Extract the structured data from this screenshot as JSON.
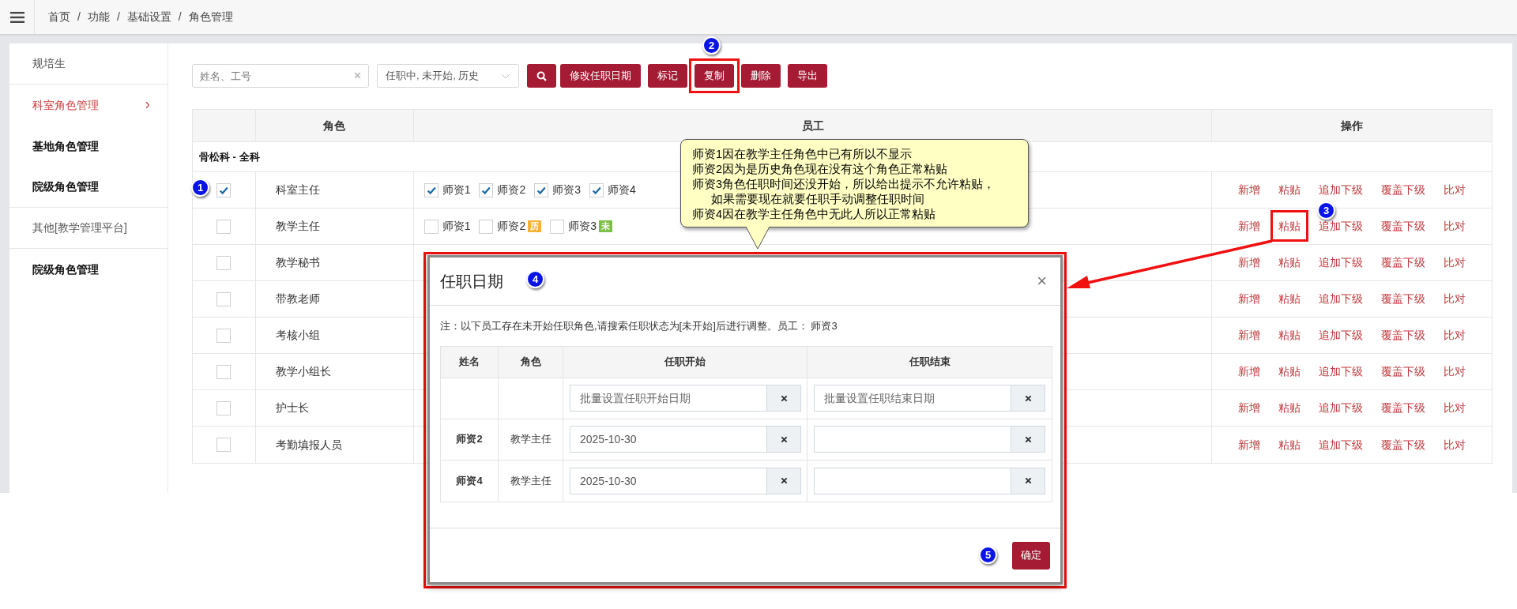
{
  "header": {
    "breadcrumb": [
      "首页",
      "功能",
      "基础设置",
      "角色管理"
    ],
    "separator": "/"
  },
  "sidebar": {
    "items": [
      {
        "label": "规培生",
        "kind": "plain",
        "selected": false,
        "divided": true
      },
      {
        "label": "科室角色管理",
        "kind": "strong",
        "selected": true,
        "divided": false
      },
      {
        "label": "基地角色管理",
        "kind": "strong",
        "selected": false,
        "divided": false
      },
      {
        "label": "院级角色管理",
        "kind": "strong",
        "selected": false,
        "divided": true
      },
      {
        "label": "其他[教学管理平台]",
        "kind": "plain",
        "selected": false,
        "divided": true
      },
      {
        "label": "院级角色管理",
        "kind": "strong",
        "selected": false,
        "divided": false
      }
    ]
  },
  "toolbar": {
    "search": {
      "placeholder": "姓名、工号"
    },
    "status_filter": {
      "value": "任职中, 未开始, 历史"
    },
    "buttons": [
      "修改任职日期",
      "标记",
      "复制",
      "删除",
      "导出"
    ]
  },
  "table": {
    "columns": [
      "角色",
      "员工",
      "操作"
    ],
    "group": "骨松科 - 全科",
    "rows": [
      {
        "checked": true,
        "role": "科室主任",
        "staff": [
          {
            "name": "师资1",
            "checked": true
          },
          {
            "name": "师资2",
            "checked": true
          },
          {
            "name": "师资3",
            "checked": true
          },
          {
            "name": "师资4",
            "checked": true
          }
        ],
        "actions": [
          "新增",
          "粘贴",
          "追加下级",
          "覆盖下级",
          "比对"
        ]
      },
      {
        "checked": false,
        "role": "教学主任",
        "staff": [
          {
            "name": "师资1",
            "checked": false
          },
          {
            "name": "师资2",
            "checked": false,
            "tag": {
              "text": "历",
              "color": "#f5b335"
            }
          },
          {
            "name": "师资3",
            "checked": false,
            "tag": {
              "text": "未",
              "color": "#7cbf45"
            }
          }
        ],
        "actions": [
          "新增",
          "粘贴",
          "追加下级",
          "覆盖下级",
          "比对"
        ]
      },
      {
        "checked": false,
        "role": "教学秘书",
        "actions": [
          "新增",
          "粘贴",
          "追加下级",
          "覆盖下级",
          "比对"
        ]
      },
      {
        "checked": false,
        "role": "带教老师",
        "actions": [
          "新增",
          "粘贴",
          "追加下级",
          "覆盖下级",
          "比对"
        ]
      },
      {
        "checked": false,
        "role": "考核小组",
        "actions": [
          "新增",
          "粘贴",
          "追加下级",
          "覆盖下级",
          "比对"
        ]
      },
      {
        "checked": false,
        "role": "教学小组长",
        "actions": [
          "新增",
          "粘贴",
          "追加下级",
          "覆盖下级",
          "比对"
        ]
      },
      {
        "checked": false,
        "role": "护士长",
        "actions": [
          "新增",
          "粘贴",
          "追加下级",
          "覆盖下级",
          "比对"
        ]
      },
      {
        "checked": false,
        "role": "考勤填报人员",
        "actions": [
          "新增",
          "粘贴",
          "追加下级",
          "覆盖下级",
          "比对"
        ]
      }
    ]
  },
  "callout": {
    "lines": [
      "师资1因在教学主任角色中已有所以不显示",
      "师资2因为是历史角色现在没有这个角色正常粘贴",
      "师资3角色任职时间还没开始，所以给出提示不允许粘贴，",
      "如果需要现在就要任职手动调整任职时间",
      "师资4因在教学主任角色中无此人所以正常粘贴"
    ]
  },
  "modal": {
    "title": "任职日期",
    "close": "×",
    "note": "注：以下员工存在未开始任职角色,请搜索任职状态为[未开始]后进行调整。员工： 师资3",
    "columns": [
      "姓名",
      "角色",
      "任职开始",
      "任职结束"
    ],
    "batch": {
      "start_placeholder": "批量设置任职开始日期",
      "end_placeholder": "批量设置任职结束日期"
    },
    "rows": [
      {
        "name": "师资2",
        "role": "教学主任",
        "start": "2025-10-30"
      },
      {
        "name": "师资4",
        "role": "教学主任",
        "start": "2025-10-30"
      }
    ],
    "confirm": "确定"
  },
  "annotations": {
    "badges": [
      "1",
      "2",
      "3",
      "4",
      "5"
    ]
  }
}
